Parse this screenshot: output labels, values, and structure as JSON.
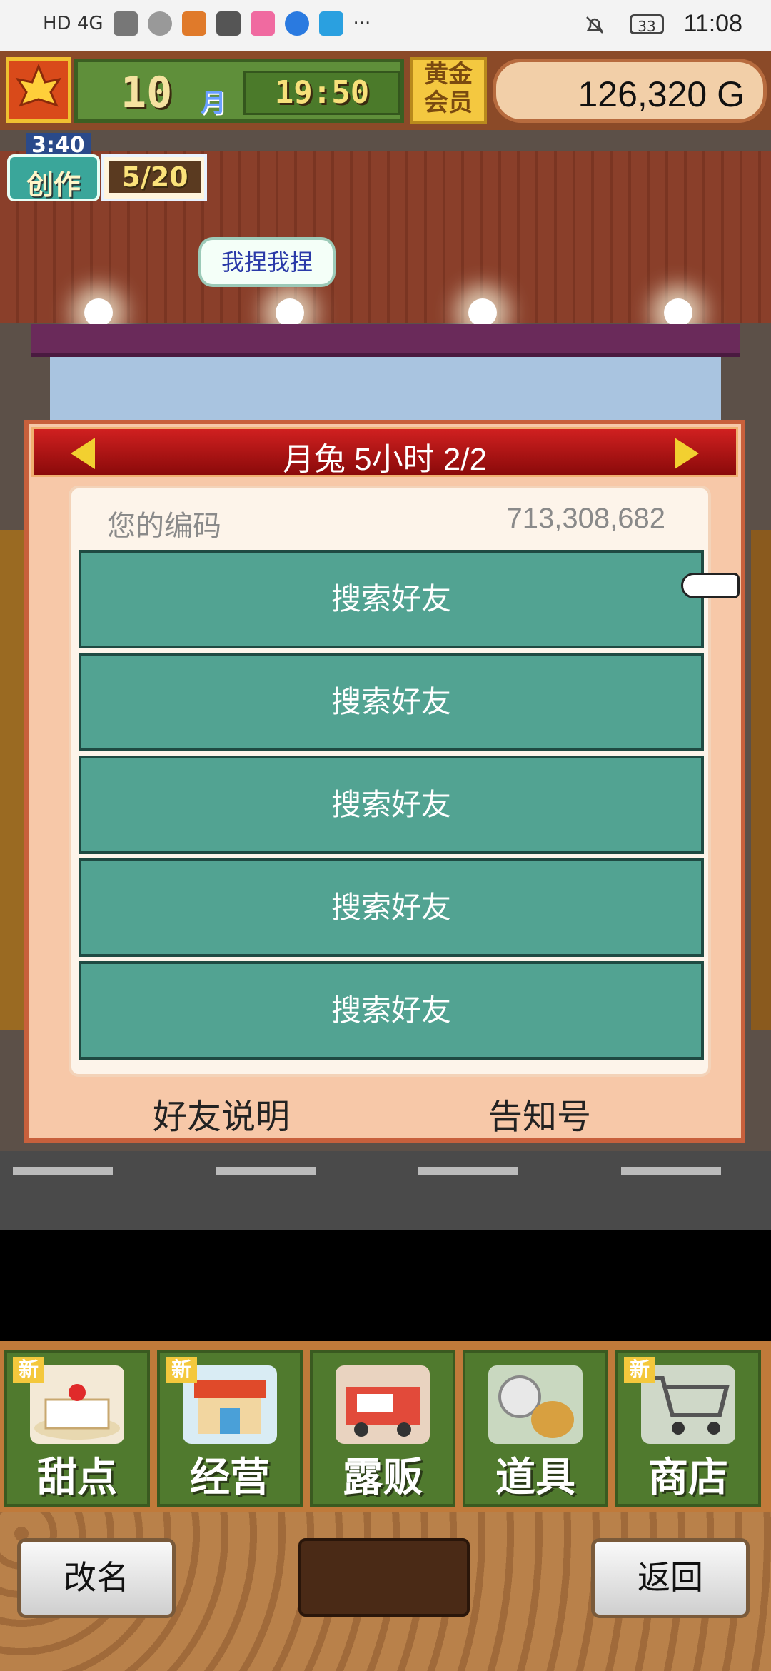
{
  "status_bar": {
    "left_text": "HD 4G",
    "battery": "33",
    "clock": "11:08",
    "overflow": "···"
  },
  "hud": {
    "month_number": "10",
    "month_label": "月",
    "time": "19:50",
    "member_badge": "黄金会员",
    "money": "126,320 G"
  },
  "create": {
    "timer": "3:40",
    "label": "创作",
    "count": "5/20"
  },
  "scene": {
    "speech_bubble": "我捏我捏"
  },
  "dialog": {
    "title": "月兔  5小时 2/2",
    "code_label": "您的编码",
    "code_value": "713,308,682",
    "search_buttons": [
      "搜索好友",
      "搜索好友",
      "搜索好友",
      "搜索好友",
      "搜索好友"
    ],
    "footer_left": "好友说明",
    "footer_right": "告知号"
  },
  "menu": {
    "items": [
      {
        "label": "甜点",
        "icon": "cake-icon",
        "new_badge": "新"
      },
      {
        "label": "经营",
        "icon": "shop-icon",
        "new_badge": "新"
      },
      {
        "label": "露贩",
        "icon": "food-truck-icon",
        "new_badge": ""
      },
      {
        "label": "道具",
        "icon": "gear-bag-icon",
        "new_badge": ""
      },
      {
        "label": "商店",
        "icon": "shopping-cart-icon",
        "new_badge": "新"
      }
    ]
  },
  "bottom": {
    "rename_label": "改名",
    "back_label": "返回"
  },
  "colors": {
    "dialog_bg": "#f7c8a8",
    "header_red": "#d02020",
    "button_teal": "#52a392",
    "menu_green": "#507a2e"
  }
}
